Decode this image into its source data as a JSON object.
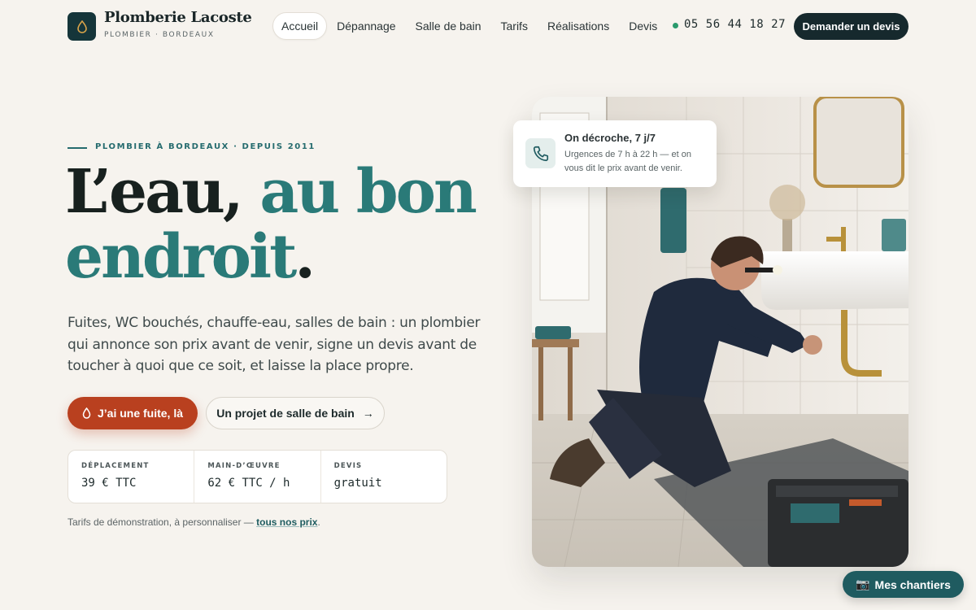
{
  "brand": {
    "name": "Plomberie Lacoste",
    "tagline": "PLOMBIER · BORDEAUX",
    "logo_icon": "water-drop-icon"
  },
  "nav": {
    "items": [
      {
        "label": "Accueil",
        "active": true
      },
      {
        "label": "Dépannage",
        "active": false
      },
      {
        "label": "Salle de bain",
        "active": false
      },
      {
        "label": "Tarifs",
        "active": false
      },
      {
        "label": "Réalisations",
        "active": false
      },
      {
        "label": "Devis",
        "active": false
      }
    ],
    "phone": "05 56 44 18 27",
    "cta": "Demander un devis"
  },
  "hero": {
    "eyebrow": "PLOMBIER À BORDEAUX · DEPUIS 2011",
    "headline_part1": "L’eau,",
    "headline_accent1": "au bon",
    "headline_accent2": "endroit",
    "headline_end": ".",
    "lede": "Fuites, WC bouchés, chauffe-eau, salles de bain : un plombier qui annonce son prix avant de venir, signe un devis avant de toucher à quoi que ce soit, et laisse la place propre.",
    "primary_button": "J’ai une fuite, là",
    "secondary_button": "Un projet de salle de bain",
    "secondary_arrow": "→"
  },
  "prices": [
    {
      "label": "DÉPLACEMENT",
      "value": "39 € TTC"
    },
    {
      "label": "MAIN-D’ŒUVRE",
      "value": "62 € TTC / h"
    },
    {
      "label": "DEVIS",
      "value": "gratuit"
    }
  ],
  "footnote": {
    "text": "Tarifs de démonstration, à personnaliser — ",
    "link": "tous nos prix",
    "end": "."
  },
  "callout": {
    "title": "On décroche, 7 j/7",
    "text": "Urgences de 7 h à 22 h — et on vous dit le prix avant de venir.",
    "icon": "phone-icon"
  },
  "fab": {
    "icon": "📷",
    "label": "Mes chantiers"
  },
  "colors": {
    "background": "#f6f3ee",
    "brand_dark": "#15353a",
    "accent_teal": "#2a7a78",
    "primary_red": "#b9401f",
    "status_green": "#2a9a6c"
  }
}
